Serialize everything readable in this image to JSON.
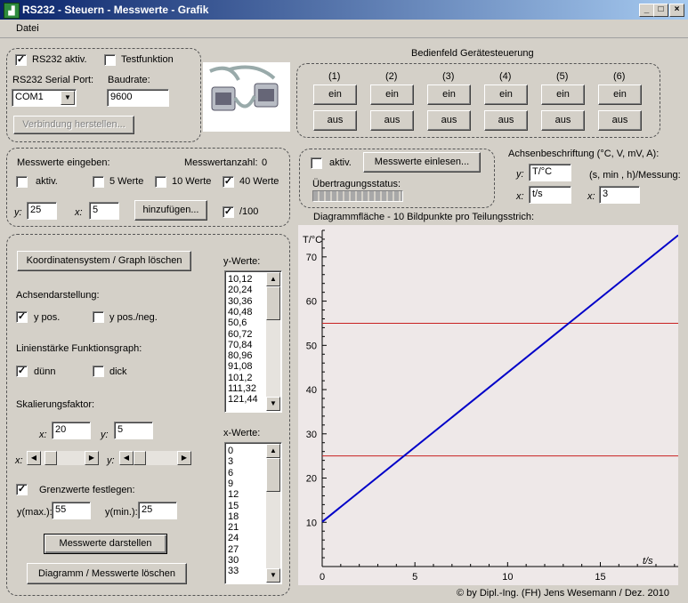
{
  "window": {
    "title": "RS232 - Steuern - Messwerte - Grafik",
    "app_icon": "chart-app-icon"
  },
  "menu": {
    "datei": "Datei"
  },
  "rs232": {
    "aktiv_label": "RS232 aktiv.",
    "aktiv_checked": true,
    "test_label": "Testfunktion",
    "test_checked": false,
    "port_label": "RS232 Serial Port:",
    "port_value": "COM1",
    "baud_label": "Baudrate:",
    "baud_value": "9600",
    "connect_label": "Verbindung herstellen..."
  },
  "panel": {
    "title": "Bedienfeld Gerätesteuerung",
    "channels": [
      "(1)",
      "(2)",
      "(3)",
      "(4)",
      "(5)",
      "(6)"
    ],
    "on_label": "ein",
    "off_label": "aus"
  },
  "input": {
    "title": "Messwerte eingeben:",
    "count_label": "Messwertanzahl:",
    "count_value": "0",
    "aktiv_label": "aktiv.",
    "aktiv_checked": false,
    "w5_label": "5 Werte",
    "w5_checked": false,
    "w10_label": "10 Werte",
    "w10_checked": false,
    "w40_label": "40 Werte",
    "w40_checked": true,
    "y_label": "y:",
    "y_value": "25",
    "x_label": "x:",
    "x_value": "5",
    "add_label": "hinzufügen...",
    "div100_label": "/100",
    "div100_checked": true
  },
  "read": {
    "aktiv_label": "aktiv.",
    "aktiv_checked": false,
    "read_label": "Messwerte einlesen...",
    "status_label": "Übertragungsstatus:",
    "progress": 0
  },
  "axislabels": {
    "title": "Achsenbeschriftung (°C, V, mV, A):",
    "y_label": "y:",
    "y_value": "T/°C",
    "x_label": "x:",
    "x_value": "t/s",
    "per_label": "(s, min , h)/Messung:",
    "per_x_label": "x:",
    "per_value": "3"
  },
  "left": {
    "clear_label": "Koordinatensystem / Graph löschen",
    "axis_title": "Achsendarstellung:",
    "ypos_label": "y  pos.",
    "ypos_checked": true,
    "yposneg_label": "y  pos./neg.",
    "yposneg_checked": false,
    "line_title": "Linienstärke Funktionsgraph:",
    "thin_label": "dünn",
    "thin_checked": true,
    "thick_label": "dick",
    "thick_checked": false,
    "scale_title": "Skalierungsfaktor:",
    "sx_label": "x:",
    "sx_value": "20",
    "sy_label": "y:",
    "sy_value": "5",
    "hx_label": "x:",
    "hy_label": "y:",
    "limits_label": "Grenzwerte festlegen:",
    "limits_checked": true,
    "ymax_label": "y(max.):",
    "ymax_value": "55",
    "ymin_label": "y(min.):",
    "ymin_value": "25",
    "show_label": "Messwerte darstellen",
    "clear2_label": "Diagramm / Messwerte löschen"
  },
  "lists": {
    "y_title": "y-Werte:",
    "y_values": [
      "10,12",
      "20,24",
      "30,36",
      "40,48",
      "50,6",
      "60,72",
      "70,84",
      "80,96",
      "91,08",
      "101,2",
      "111,32",
      "121,44"
    ],
    "x_title": "x-Werte:",
    "x_values": [
      "0",
      "3",
      "6",
      "9",
      "12",
      "15",
      "18",
      "21",
      "24",
      "27",
      "30",
      "33"
    ]
  },
  "chart_caption": "Diagrammfläche - 10 Bildpunkte pro Teilungsstrich:",
  "chart_data": {
    "type": "line",
    "ylabel": "T/°C",
    "xlabel": "t/s",
    "xlim": [
      0,
      19.2
    ],
    "ylim": [
      0,
      76
    ],
    "x_ticks": [
      "0",
      "5",
      "10",
      "15"
    ],
    "y_ticks": [
      "10",
      "20",
      "30",
      "40",
      "50",
      "60",
      "70"
    ],
    "series": [
      {
        "x": [
          0,
          19.2
        ],
        "y": [
          10.12,
          74.9
        ]
      }
    ],
    "hlines": [
      55,
      25
    ],
    "line_color": "#0000c8",
    "limit_color": "#c82020",
    "background": "#eee8e8"
  },
  "footer": "© by Dipl.-Ing. (FH) Jens Wesemann / Dez. 2010"
}
